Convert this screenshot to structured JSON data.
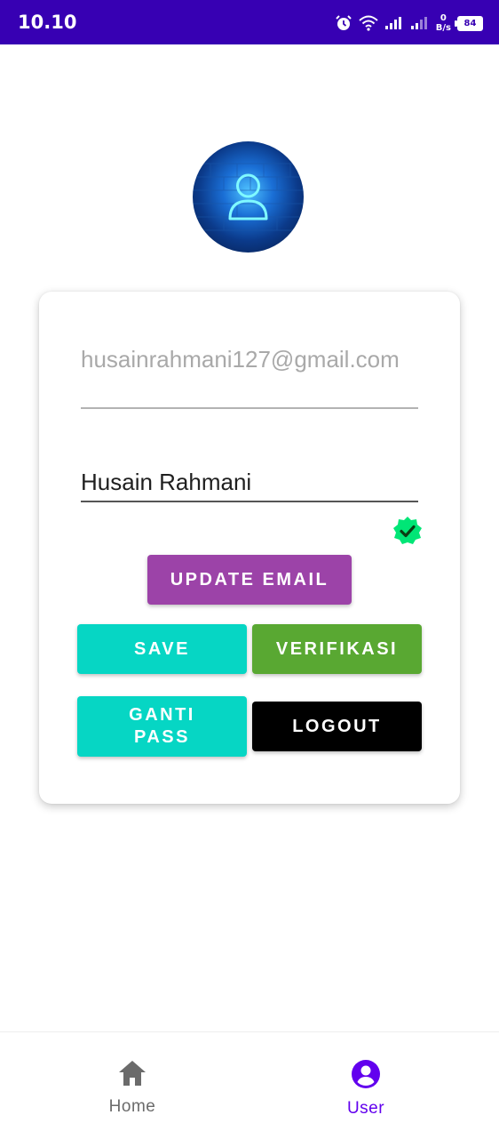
{
  "status_bar": {
    "time": "10.10",
    "net_speed_value": "0",
    "net_speed_unit": "B/s",
    "battery": "84",
    "icons": [
      "alarm-icon",
      "wifi-icon",
      "signal-icon",
      "signal-icon",
      "battery-icon"
    ]
  },
  "profile": {
    "avatar_icon": "user-neon-icon",
    "email": "husainrahmani127@gmail.com",
    "name": "Husain Rahmani",
    "verified_icon": "verified-badge-icon",
    "verified_color": "#00e676"
  },
  "buttons": {
    "update_email": "UPDATE EMAIL",
    "save": "SAVE",
    "verifikasi": "VERIFIKASI",
    "ganti_pass_line1": "GANTI",
    "ganti_pass_line2": "PASS",
    "logout": "LOGOUT"
  },
  "bottom_nav": {
    "items": [
      {
        "label": "Home",
        "icon": "home-icon",
        "active": false
      },
      {
        "label": "User",
        "icon": "account-circle-icon",
        "active": true
      }
    ]
  },
  "colors": {
    "status_bar": "#3700b3",
    "update_email": "#9c43a8",
    "save": "#06d6c4",
    "verifikasi": "#59a832",
    "logout": "#000000",
    "active_nav": "#6200ee"
  }
}
